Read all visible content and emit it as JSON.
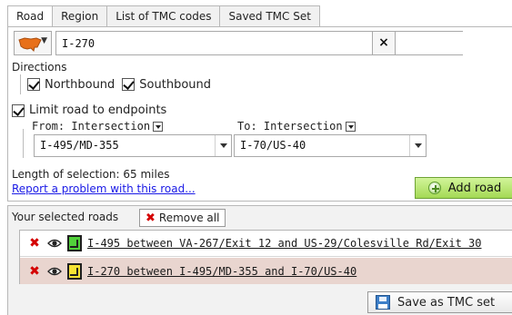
{
  "tabs": [
    {
      "label": "Road",
      "active": true
    },
    {
      "label": "Region",
      "active": false
    },
    {
      "label": "List of TMC codes",
      "active": false
    },
    {
      "label": "Saved TMC Set",
      "active": false
    }
  ],
  "road": {
    "country_icon": "us-map-icon",
    "road_value": "I-270",
    "clear_symbol": "×"
  },
  "directions": {
    "label": "Directions",
    "northbound": {
      "label": "Northbound",
      "checked": true
    },
    "southbound": {
      "label": "Southbound",
      "checked": true
    }
  },
  "limit": {
    "label": "Limit road to endpoints",
    "checked": true,
    "from_label": "From: Intersection",
    "to_label": "To: Intersection",
    "from_value": "I-495/MD-355",
    "to_value": "I-70/US-40"
  },
  "length": {
    "text": "Length of selection: 65 miles"
  },
  "report_link": "Report a problem with this road...",
  "add_road_label": "Add road",
  "selected": {
    "title": "Your selected roads",
    "remove_all_label": "Remove all",
    "roads": [
      {
        "label": "I-495 between VA-267/Exit 12 and US-29/Colesville Rd/Exit 30",
        "color": "#51d13a"
      },
      {
        "label": "I-270 between I-495/MD-355 and I-70/US-40",
        "color": "#f6e234"
      }
    ],
    "save_label": "Save as TMC set"
  },
  "colors": {
    "accent_green": "#a4d955",
    "remove_red": "#d40000",
    "selected_row": "#e9d5cf",
    "link_blue": "#1a1ae6"
  }
}
